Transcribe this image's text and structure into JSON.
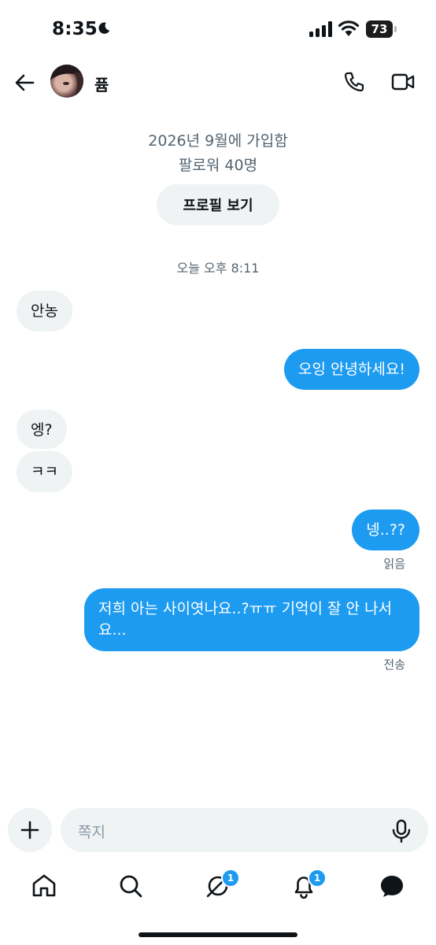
{
  "status_bar": {
    "time": "8:35",
    "battery": "73"
  },
  "header": {
    "name": "퓸",
    "back_icon": "arrow-left-icon",
    "call_icon": "phone-icon",
    "video_icon": "video-camera-icon"
  },
  "profile": {
    "joined": "2026년 9월에 가입함",
    "followers": "팔로워 40명",
    "view_profile_label": "프로필 보기"
  },
  "conversation": {
    "timestamp": "오늘 오후 8:11",
    "messages": [
      {
        "side": "received",
        "text": "안농"
      },
      {
        "side": "sent",
        "text": "오잉 안녕하세요!"
      },
      {
        "side": "received",
        "text": "엥?"
      },
      {
        "side": "received",
        "text": "ㅋㅋ"
      },
      {
        "side": "sent",
        "text": "넹..??",
        "status": "읽음"
      },
      {
        "side": "sent",
        "text": "저희 아는 사이엿나요..?ㅠㅠ 기억이 잘 안 나서요...",
        "status": "전송"
      }
    ]
  },
  "composer": {
    "placeholder": "쪽지"
  },
  "tab_bar": {
    "items": [
      {
        "icon": "home-icon"
      },
      {
        "icon": "search-icon"
      },
      {
        "icon": "grok-icon",
        "badge": "1"
      },
      {
        "icon": "bell-icon",
        "badge": "1"
      },
      {
        "icon": "messages-icon"
      }
    ]
  },
  "colors": {
    "accent": "#1d9bf0",
    "received_bubble": "#eff3f4",
    "text": "#0f1419",
    "secondary_text": "#536471"
  }
}
